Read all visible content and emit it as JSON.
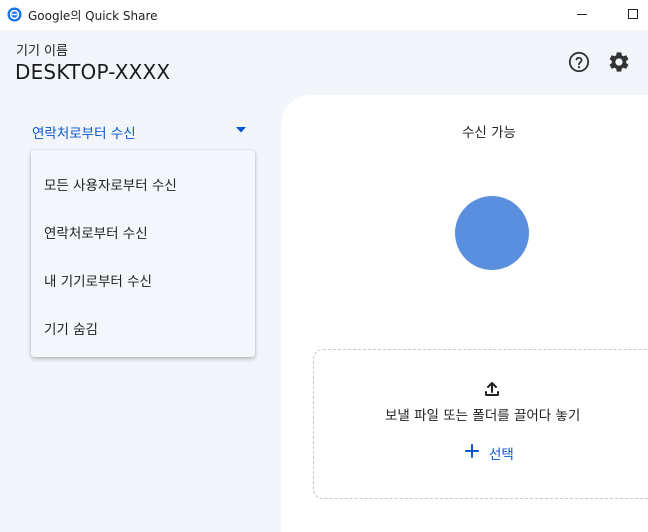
{
  "window": {
    "title": "Google의 Quick Share"
  },
  "header": {
    "device_label": "기기 이름",
    "device_name": "DESKTOP-XXXX"
  },
  "receive": {
    "selected": "연락처로부터 수신",
    "options": [
      "모든 사용자로부터 수신",
      "연락처로부터 수신",
      "내 기기로부터 수신",
      "기기 숨김"
    ]
  },
  "main": {
    "status": "수신 가능",
    "drop_text": "보낼 파일 또는 폴더를 끌어다 놓기",
    "select_label": "선택"
  },
  "colors": {
    "accent": "#0b57d0",
    "avatar": "#5a8ede",
    "background": "#f2f5fa"
  },
  "icons": [
    "quick-share-icon",
    "help-icon",
    "settings-icon",
    "chevron-down-icon",
    "upload-icon",
    "plus-icon"
  ]
}
